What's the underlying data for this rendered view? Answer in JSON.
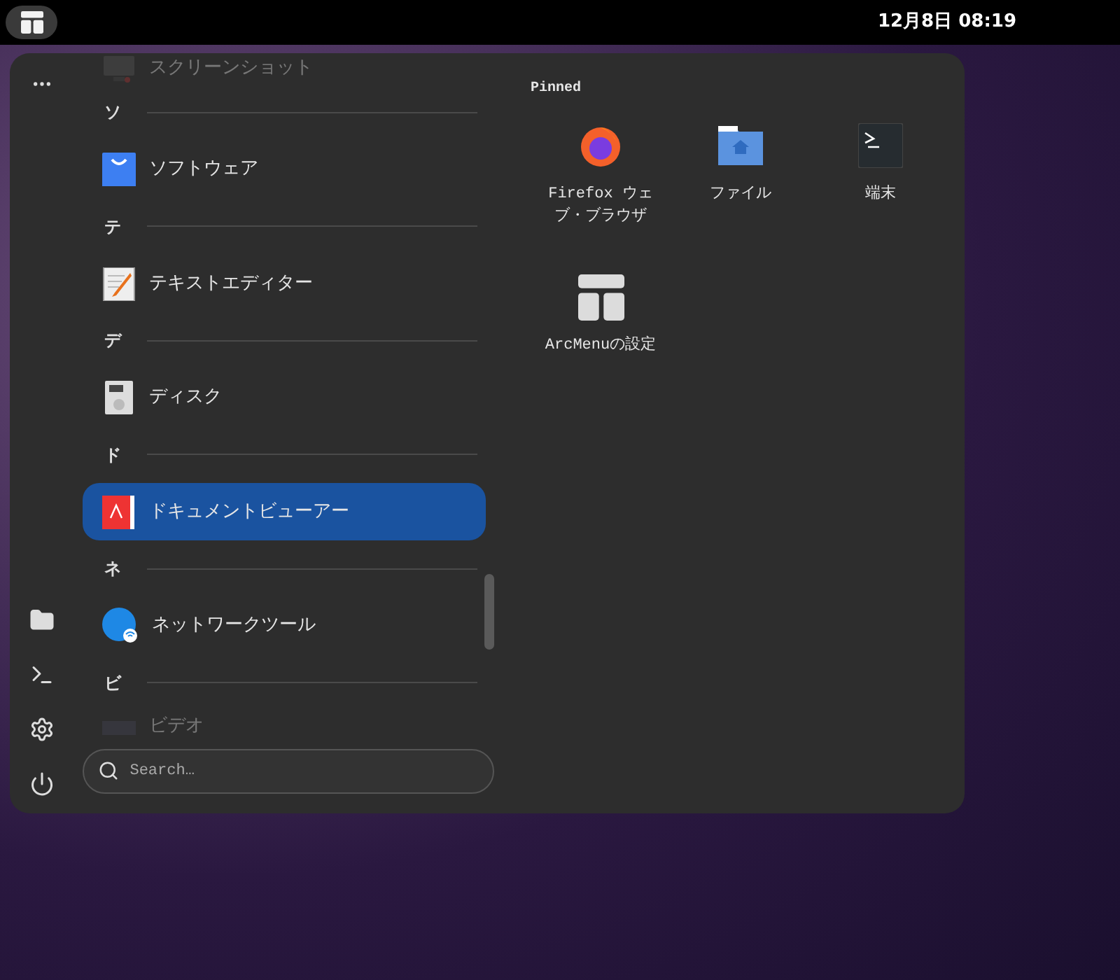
{
  "top_bar": {
    "clock": "12月8日 08:19"
  },
  "app_list": [
    {
      "kind": "partial",
      "label": "スクリーンショット",
      "selected": false
    },
    {
      "kind": "header",
      "label": "ソ"
    },
    {
      "kind": "app",
      "label": "ソフトウェア",
      "selected": false
    },
    {
      "kind": "header",
      "label": "テ"
    },
    {
      "kind": "app",
      "label": "テキストエディター",
      "selected": false
    },
    {
      "kind": "header",
      "label": "デ"
    },
    {
      "kind": "app",
      "label": "ディスク",
      "selected": false
    },
    {
      "kind": "header",
      "label": "ド"
    },
    {
      "kind": "app",
      "label": "ドキュメントビューアー",
      "selected": true
    },
    {
      "kind": "header",
      "label": "ネ"
    },
    {
      "kind": "app",
      "label": "ネットワークツール",
      "selected": false
    },
    {
      "kind": "header",
      "label": "ビ"
    },
    {
      "kind": "partial",
      "label": "ビデオ",
      "selected": false
    }
  ],
  "search": {
    "placeholder": "Search…"
  },
  "pinned": {
    "title": "Pinned",
    "items": [
      {
        "label": "Firefox ウェブ・ブラウザ"
      },
      {
        "label": "ファイル"
      },
      {
        "label": "端末"
      },
      {
        "label": "ArcMenuの設定"
      }
    ]
  }
}
